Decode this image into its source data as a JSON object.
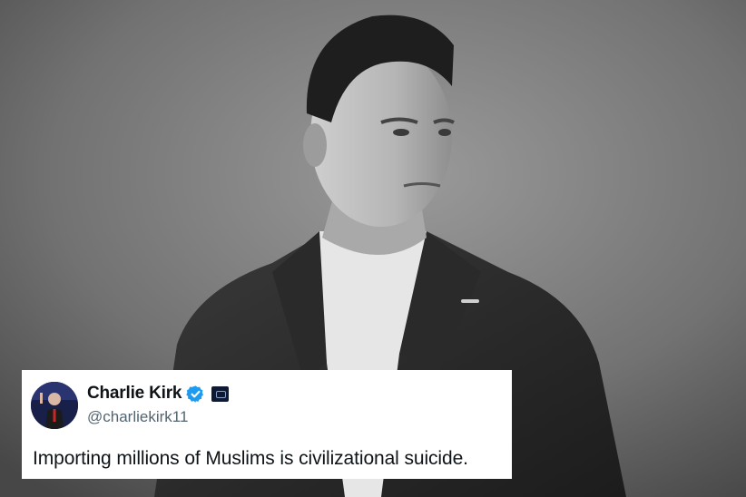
{
  "tweet": {
    "author_name": "Charlie Kirk",
    "handle": "@charliekirk11",
    "text": "Importing millions of Muslims is civilizational suicide.",
    "verified_badge_icon": "verified-badge-icon",
    "affiliate_badge_icon": "affiliate-badge-icon",
    "badge_color": "#1d9bf0"
  },
  "photo": {
    "style": "black-and-white portrait"
  }
}
